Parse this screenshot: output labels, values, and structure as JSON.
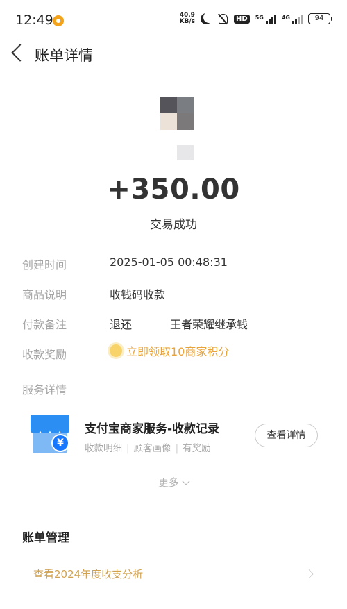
{
  "status_bar": {
    "time": "12:49",
    "net_speed_value": "40.9",
    "net_speed_unit": "KB/s",
    "hd": "HD",
    "net1": "5G",
    "net2": "4G",
    "battery": "94"
  },
  "nav": {
    "title": "账单详情"
  },
  "bill": {
    "amount": "+350.00",
    "status": "交易成功"
  },
  "details": {
    "created_label": "创建时间",
    "created_value": "2025-01-05 00:48:31",
    "desc_label": "商品说明",
    "desc_value": "收钱码收款",
    "remark_label": "付款备注",
    "remark_value_a": "退还",
    "remark_value_b": "王者荣耀继承钱",
    "reward_label": "收款奖励",
    "reward_value": "立即领取10商家积分",
    "service_label": "服务详情"
  },
  "service": {
    "title": "支付宝商家服务-收款记录",
    "tags": [
      "收款明细",
      "顾客画像",
      "有奖励"
    ],
    "button": "查看详情",
    "more": "更多"
  },
  "management": {
    "title": "账单管理",
    "analysis_link": "查看2024年度收支分析"
  },
  "colors": {
    "label_gray": "#a5a5a5",
    "reward_orange": "#e8a33a",
    "link_gold": "#d0a14f",
    "brand_blue": "#1677ff"
  }
}
